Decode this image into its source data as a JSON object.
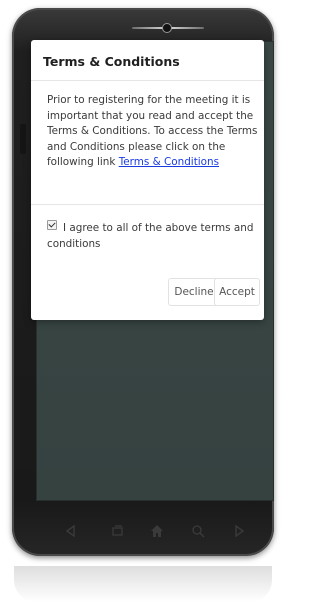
{
  "dialog": {
    "title": "Terms & Conditions",
    "body_text": "Prior to registering for the meeting it is important that you read and accept the Terms & Conditions. To access the Terms and Conditions please click on the following link ",
    "link_text": "Terms & Conditions",
    "checkbox_label": "I agree to all of the above terms and conditions",
    "checkbox_checked": true,
    "decline_label": "Decline",
    "accept_label": "Accept"
  },
  "nav_icons": [
    "back-icon",
    "recent-apps-icon",
    "home-icon",
    "search-icon",
    "menu-icon"
  ],
  "colors": {
    "screen": "#3d4b49",
    "link": "#1a3be0",
    "dialog_bg": "#ffffff"
  }
}
